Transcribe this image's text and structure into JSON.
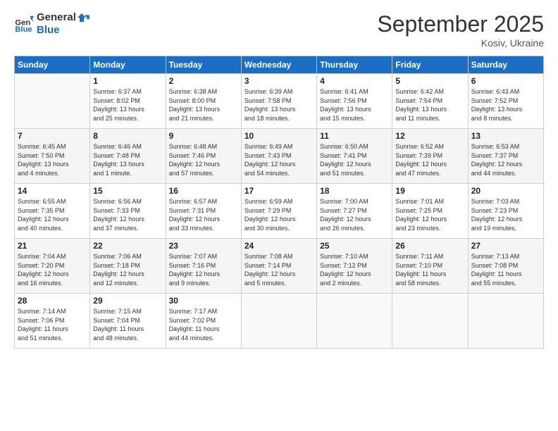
{
  "header": {
    "logo_line1": "General",
    "logo_line2": "Blue",
    "month": "September 2025",
    "location": "Kosiv, Ukraine"
  },
  "weekdays": [
    "Sunday",
    "Monday",
    "Tuesday",
    "Wednesday",
    "Thursday",
    "Friday",
    "Saturday"
  ],
  "weeks": [
    [
      {
        "day": "",
        "info": ""
      },
      {
        "day": "1",
        "info": "Sunrise: 6:37 AM\nSunset: 8:02 PM\nDaylight: 13 hours\nand 25 minutes."
      },
      {
        "day": "2",
        "info": "Sunrise: 6:38 AM\nSunset: 8:00 PM\nDaylight: 13 hours\nand 21 minutes."
      },
      {
        "day": "3",
        "info": "Sunrise: 6:39 AM\nSunset: 7:58 PM\nDaylight: 13 hours\nand 18 minutes."
      },
      {
        "day": "4",
        "info": "Sunrise: 6:41 AM\nSunset: 7:56 PM\nDaylight: 13 hours\nand 15 minutes."
      },
      {
        "day": "5",
        "info": "Sunrise: 6:42 AM\nSunset: 7:54 PM\nDaylight: 13 hours\nand 11 minutes."
      },
      {
        "day": "6",
        "info": "Sunrise: 6:43 AM\nSunset: 7:52 PM\nDaylight: 13 hours\nand 8 minutes."
      }
    ],
    [
      {
        "day": "7",
        "info": "Sunrise: 6:45 AM\nSunset: 7:50 PM\nDaylight: 13 hours\nand 4 minutes."
      },
      {
        "day": "8",
        "info": "Sunrise: 6:46 AM\nSunset: 7:48 PM\nDaylight: 13 hours\nand 1 minute."
      },
      {
        "day": "9",
        "info": "Sunrise: 6:48 AM\nSunset: 7:46 PM\nDaylight: 12 hours\nand 57 minutes."
      },
      {
        "day": "10",
        "info": "Sunrise: 6:49 AM\nSunset: 7:43 PM\nDaylight: 12 hours\nand 54 minutes."
      },
      {
        "day": "11",
        "info": "Sunrise: 6:50 AM\nSunset: 7:41 PM\nDaylight: 12 hours\nand 51 minutes."
      },
      {
        "day": "12",
        "info": "Sunrise: 6:52 AM\nSunset: 7:39 PM\nDaylight: 12 hours\nand 47 minutes."
      },
      {
        "day": "13",
        "info": "Sunrise: 6:53 AM\nSunset: 7:37 PM\nDaylight: 12 hours\nand 44 minutes."
      }
    ],
    [
      {
        "day": "14",
        "info": "Sunrise: 6:55 AM\nSunset: 7:35 PM\nDaylight: 12 hours\nand 40 minutes."
      },
      {
        "day": "15",
        "info": "Sunrise: 6:56 AM\nSunset: 7:33 PM\nDaylight: 12 hours\nand 37 minutes."
      },
      {
        "day": "16",
        "info": "Sunrise: 6:57 AM\nSunset: 7:31 PM\nDaylight: 12 hours\nand 33 minutes."
      },
      {
        "day": "17",
        "info": "Sunrise: 6:59 AM\nSunset: 7:29 PM\nDaylight: 12 hours\nand 30 minutes."
      },
      {
        "day": "18",
        "info": "Sunrise: 7:00 AM\nSunset: 7:27 PM\nDaylight: 12 hours\nand 26 minutes."
      },
      {
        "day": "19",
        "info": "Sunrise: 7:01 AM\nSunset: 7:25 PM\nDaylight: 12 hours\nand 23 minutes."
      },
      {
        "day": "20",
        "info": "Sunrise: 7:03 AM\nSunset: 7:23 PM\nDaylight: 12 hours\nand 19 minutes."
      }
    ],
    [
      {
        "day": "21",
        "info": "Sunrise: 7:04 AM\nSunset: 7:20 PM\nDaylight: 12 hours\nand 16 minutes."
      },
      {
        "day": "22",
        "info": "Sunrise: 7:06 AM\nSunset: 7:18 PM\nDaylight: 12 hours\nand 12 minutes."
      },
      {
        "day": "23",
        "info": "Sunrise: 7:07 AM\nSunset: 7:16 PM\nDaylight: 12 hours\nand 9 minutes."
      },
      {
        "day": "24",
        "info": "Sunrise: 7:08 AM\nSunset: 7:14 PM\nDaylight: 12 hours\nand 5 minutes."
      },
      {
        "day": "25",
        "info": "Sunrise: 7:10 AM\nSunset: 7:12 PM\nDaylight: 12 hours\nand 2 minutes."
      },
      {
        "day": "26",
        "info": "Sunrise: 7:11 AM\nSunset: 7:10 PM\nDaylight: 11 hours\nand 58 minutes."
      },
      {
        "day": "27",
        "info": "Sunrise: 7:13 AM\nSunset: 7:08 PM\nDaylight: 11 hours\nand 55 minutes."
      }
    ],
    [
      {
        "day": "28",
        "info": "Sunrise: 7:14 AM\nSunset: 7:06 PM\nDaylight: 11 hours\nand 51 minutes."
      },
      {
        "day": "29",
        "info": "Sunrise: 7:15 AM\nSunset: 7:04 PM\nDaylight: 11 hours\nand 48 minutes."
      },
      {
        "day": "30",
        "info": "Sunrise: 7:17 AM\nSunset: 7:02 PM\nDaylight: 11 hours\nand 44 minutes."
      },
      {
        "day": "",
        "info": ""
      },
      {
        "day": "",
        "info": ""
      },
      {
        "day": "",
        "info": ""
      },
      {
        "day": "",
        "info": ""
      }
    ]
  ]
}
